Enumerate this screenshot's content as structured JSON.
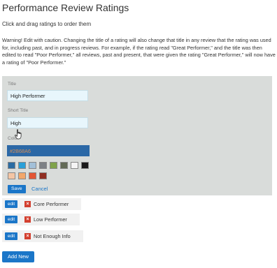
{
  "page": {
    "title": "Performance Review Ratings",
    "instructions": "Click and drag ratings to order them",
    "warning": "Warning! Edit with caution. Changing the title of a rating will also change that title in any review that the rating was used for, including past, and in progress reviews. For example, if the rating read \"Great Performer,\" and the title was then edited to read \"Poor Performer,\" all reviews, past and present, that were given the rating \"Great Performer,\" will now have a rating of \"Poor Performer.\""
  },
  "edit_form": {
    "title_label": "Title",
    "title_value": "High Performer",
    "short_title_label": "Short Title",
    "short_title_value": "High",
    "color_label": "Color",
    "color_value": "#2B68A6",
    "swatch_colors": [
      "#2b6ca3",
      "#2aa0d8",
      "#a3c0d8",
      "#7d8185",
      "#7fa34a",
      "#626a55",
      "#f4f4f4",
      "#1a1a1a",
      "#f4c5a4",
      "#f3a76a",
      "#e35635",
      "#8f2e22"
    ],
    "save_label": "Save",
    "cancel_label": "Cancel"
  },
  "ratings": [
    {
      "edit_label": "edit",
      "delete_label": "×",
      "label": "Core Performer"
    },
    {
      "edit_label": "edit",
      "delete_label": "×",
      "label": "Low Performer"
    },
    {
      "edit_label": "edit",
      "delete_label": "×",
      "label": "Not Enough Info"
    }
  ],
  "add_new_label": "Add New",
  "colors": {
    "accent": "#1b76c8",
    "panel_bg": "#d9dcda",
    "delete_red": "#d33f2e"
  }
}
